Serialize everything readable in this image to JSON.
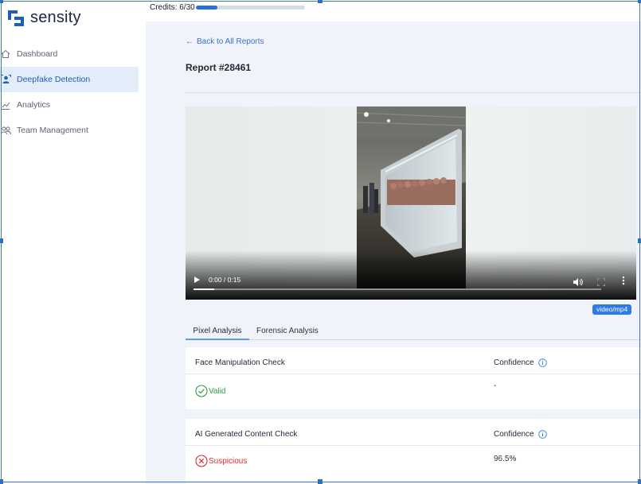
{
  "app": {
    "logo_text": "sensity",
    "brand_color": "#1d5fb4"
  },
  "sidebar": {
    "items": [
      {
        "label": "Dashboard",
        "icon": "home-icon",
        "active": false
      },
      {
        "label": "Deepfake Detection",
        "icon": "user-scan-icon",
        "active": true
      },
      {
        "label": "Analytics",
        "icon": "line-chart-icon",
        "active": false
      },
      {
        "label": "Team Management",
        "icon": "users-icon",
        "active": false
      }
    ]
  },
  "credits": {
    "label": "Credits: 6/30",
    "used": 6,
    "total": 30
  },
  "report": {
    "back_label": "Back to All Reports",
    "title": "Report #28461"
  },
  "video": {
    "time": "0:00 / 0:15",
    "progress_fraction": 0.05,
    "mime_type": "video/mp4"
  },
  "tabs": [
    {
      "label": "Pixel Analysis",
      "active": true
    },
    {
      "label": "Forensic Analysis",
      "active": false
    }
  ],
  "checks": [
    {
      "name": "Face Manipulation Check",
      "confidence_label": "Confidence",
      "status": "Valid",
      "status_icon": "check-circle-icon",
      "confidence": "-"
    },
    {
      "name": "AI Generated Content Check",
      "confidence_label": "Confidence",
      "status": "Suspicious",
      "status_icon": "x-circle-icon",
      "confidence": "96.5%"
    }
  ]
}
